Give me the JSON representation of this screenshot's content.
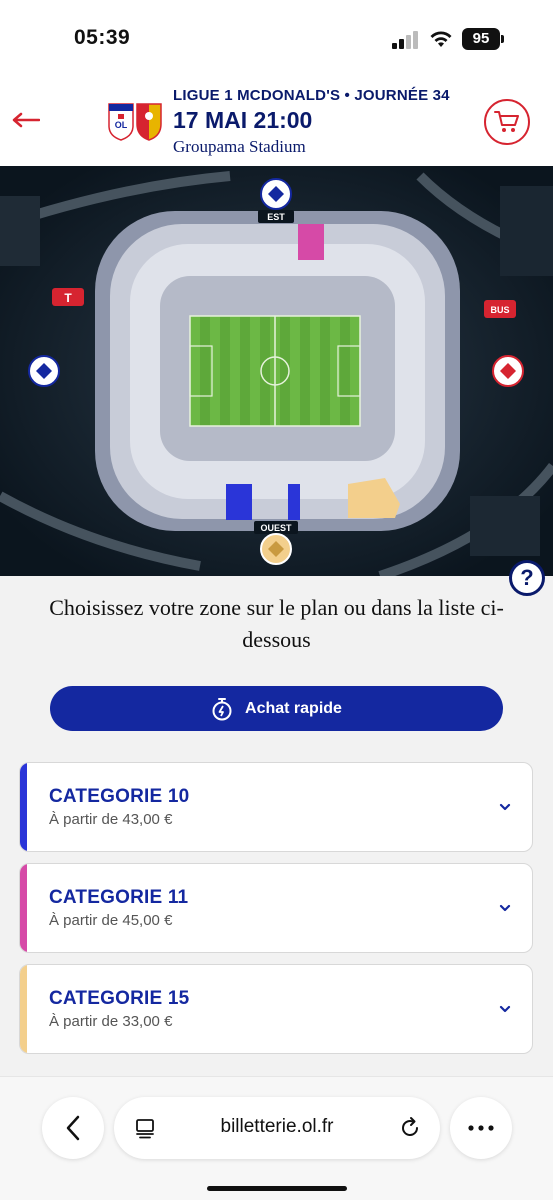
{
  "status_bar": {
    "time": "05:39",
    "battery": "95"
  },
  "header": {
    "league": "LIGUE 1 MCDONALD'S • JOURNÉE 34",
    "date": "17 MAI 21:00",
    "venue": "Groupama Stadium"
  },
  "map": {
    "est_label": "EST",
    "ouest_label": "OUEST",
    "tram_label": "T",
    "bus_label": "BUS",
    "help_label": "?"
  },
  "instruction": "Choisissez votre zone sur le plan ou dans la liste ci-dessous",
  "quick_buy_label": "Achat rapide",
  "categories": [
    {
      "name": "CATEGORIE 10",
      "price": "À partir de 43,00 €",
      "color": "#2a35d8"
    },
    {
      "name": "CATEGORIE 11",
      "price": "À partir de 45,00 €",
      "color": "#d64aa7"
    },
    {
      "name": "CATEGORIE 15",
      "price": "À partir de 33,00 €",
      "color": "#f3cf8c"
    }
  ],
  "browser": {
    "url": "billetterie.ol.fr"
  },
  "colors": {
    "brand_blue": "#1428a0",
    "navy": "#0a1a6b",
    "red": "#d62430"
  }
}
